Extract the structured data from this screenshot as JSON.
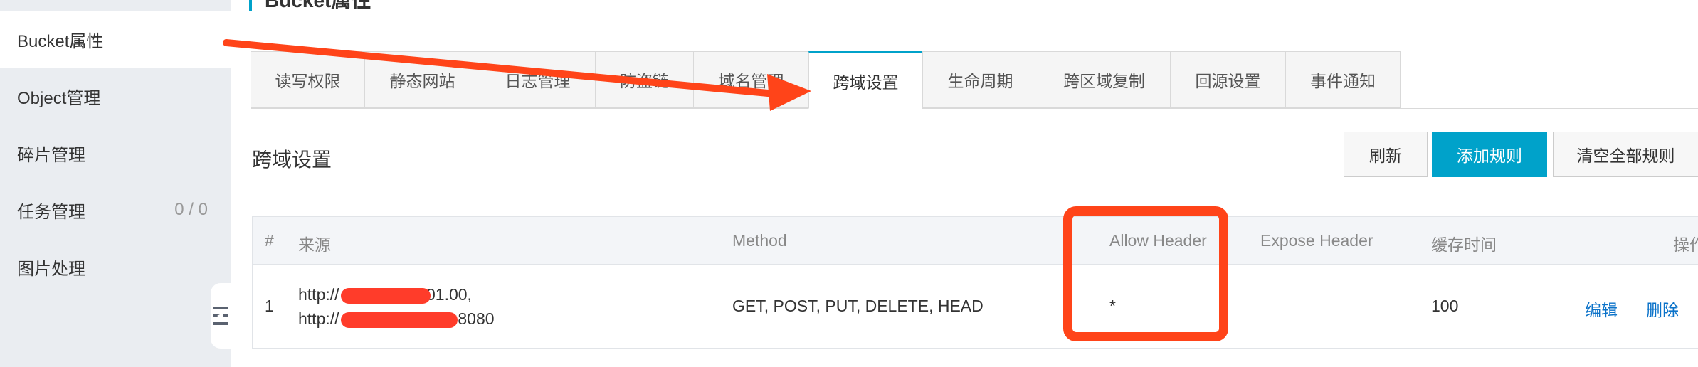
{
  "page": {
    "title": "Bucket属性"
  },
  "sidebar": {
    "items": [
      {
        "label": "Bucket属性",
        "count": ""
      },
      {
        "label": "Object管理",
        "count": ""
      },
      {
        "label": "碎片管理",
        "count": ""
      },
      {
        "label": "任务管理",
        "count": "0 / 0"
      },
      {
        "label": "图片处理",
        "count": ""
      }
    ],
    "collapse_icon": "collapse-sidebar-icon"
  },
  "tabs": [
    {
      "label": "读写权限"
    },
    {
      "label": "静态网站"
    },
    {
      "label": "日志管理"
    },
    {
      "label": "防盗链"
    },
    {
      "label": "域名管理"
    },
    {
      "label": "跨域设置"
    },
    {
      "label": "生命周期"
    },
    {
      "label": "跨区域复制"
    },
    {
      "label": "回源设置"
    },
    {
      "label": "事件通知"
    }
  ],
  "section": {
    "title": "跨域设置",
    "refresh_label": "刷新",
    "add_rule_label": "添加规则",
    "clear_all_label": "清空全部规则"
  },
  "table": {
    "headers": {
      "index": "#",
      "origin": "来源",
      "method": "Method",
      "allow_header": "Allow Header",
      "expose_header": "Expose Header",
      "max_age": "缓存时间",
      "actions": "操作"
    },
    "rows": [
      {
        "index": "1",
        "origin_line1_prefix": "http://",
        "origin_line1_suffix": "01.00,",
        "origin_line2_prefix": "http://",
        "origin_line2_suffix": ":8080",
        "method": "GET, POST, PUT, DELETE, HEAD",
        "allow_header": "*",
        "expose_header": "",
        "max_age": "100",
        "edit_label": "编辑",
        "delete_label": "删除"
      }
    ]
  },
  "annotation_color": "#ff4419",
  "accent_color": "#00a2ca"
}
